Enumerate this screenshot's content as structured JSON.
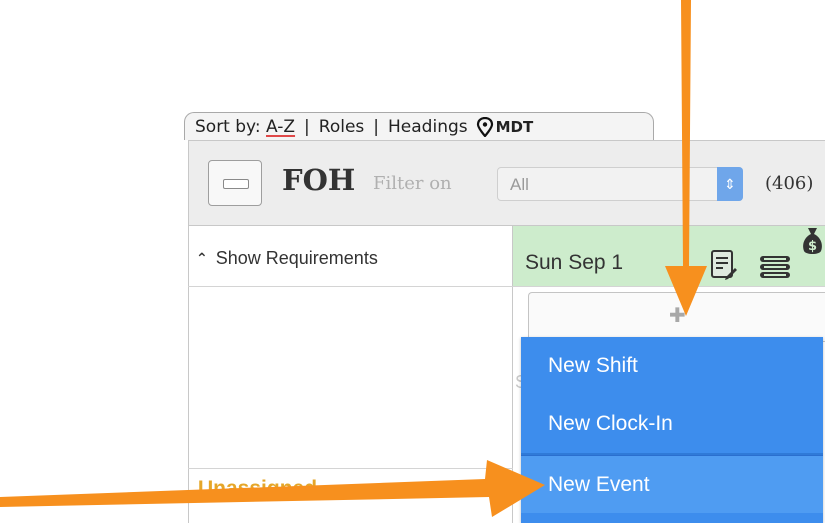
{
  "sort": {
    "prefix": "Sort by:",
    "az": "A-Z",
    "separator": "|",
    "roles": "Roles",
    "headings": "Headings",
    "timezone": "MDT"
  },
  "header": {
    "group": "FOH",
    "filter_label": "Filter on",
    "filter_value": "All",
    "phone": "(406)"
  },
  "requirements": {
    "label": "Show Requirements"
  },
  "day": {
    "label": "Sun Sep 1"
  },
  "menu": {
    "items": [
      {
        "label": "New Shift"
      },
      {
        "label": "New Clock-In"
      },
      {
        "label": "New Event"
      }
    ]
  },
  "unassigned": {
    "label": "Unassigned"
  },
  "colors": {
    "menu_bg": "#3d8ded",
    "day_bg": "#cdeccc",
    "arrow": "#f7901e",
    "unassigned": "#e5a628"
  }
}
